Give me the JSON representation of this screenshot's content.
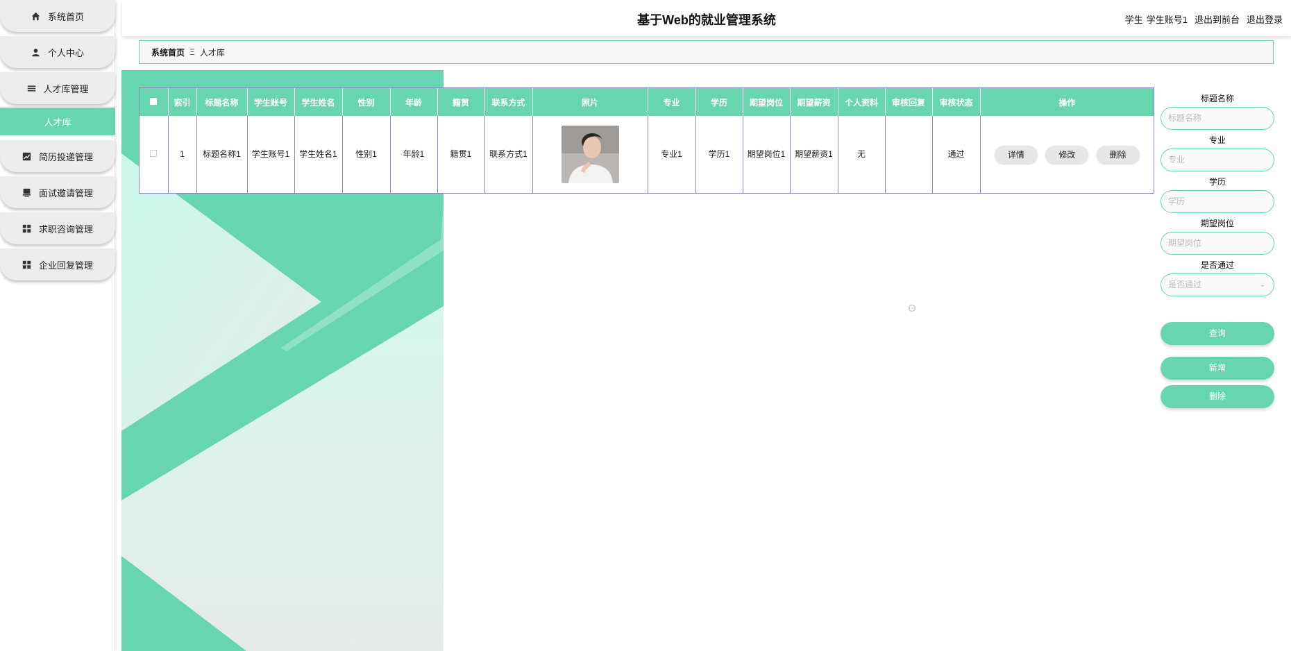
{
  "app": {
    "title": "基于Web的就业管理系统",
    "user_role": "学生",
    "user_account": "学生账号1",
    "back_to_front": "退出到前台",
    "logout": "退出登录"
  },
  "sidebar": {
    "items": [
      {
        "label": "系统首页",
        "icon": "home-icon"
      },
      {
        "label": "个人中心",
        "icon": "user-icon"
      },
      {
        "label": "人才库管理",
        "icon": "list-icon"
      },
      {
        "label": "人才库",
        "icon": ""
      },
      {
        "label": "简历投递管理",
        "icon": "chart-icon"
      },
      {
        "label": "面试邀请管理",
        "icon": "stamp-icon"
      },
      {
        "label": "求职咨询管理",
        "icon": "grid-icon"
      },
      {
        "label": "企业回复管理",
        "icon": "grid-icon"
      }
    ]
  },
  "breadcrumb": {
    "home": "系统首页",
    "separator": "Ξ",
    "current": "人才库"
  },
  "table": {
    "headers": [
      "索引",
      "标题名称",
      "学生账号",
      "学生姓名",
      "性别",
      "年龄",
      "籍贯",
      "联系方式",
      "照片",
      "专业",
      "学历",
      "期望岗位",
      "期望薪资",
      "个人资料",
      "审核回复",
      "审核状态",
      "操作"
    ],
    "rows": [
      {
        "index": "1",
        "title": "标题名称1",
        "account": "学生账号1",
        "name": "学生姓名1",
        "gender": "性别1",
        "age": "年龄1",
        "native": "籍贯1",
        "contact": "联系方式1",
        "major": "专业1",
        "education": "学历1",
        "position": "期望岗位1",
        "salary": "期望薪资1",
        "profile": "无",
        "reply": "",
        "status": "通过",
        "actions": {
          "detail": "详情",
          "edit": "修改",
          "delete": "删除"
        }
      }
    ]
  },
  "search": {
    "title_label": "标题名称",
    "title_placeholder": "标题名称",
    "major_label": "专业",
    "major_placeholder": "专业",
    "edu_label": "学历",
    "edu_placeholder": "学历",
    "position_label": "期望岗位",
    "position_placeholder": "期望岗位",
    "pass_label": "是否通过",
    "pass_placeholder": "是否通过",
    "query_button": "查询",
    "add_button": "新增",
    "delete_button": "删除"
  },
  "colors": {
    "accent": "#66d5b0",
    "accent_light": "#c9f7ea",
    "border": "#8a8ab8"
  }
}
